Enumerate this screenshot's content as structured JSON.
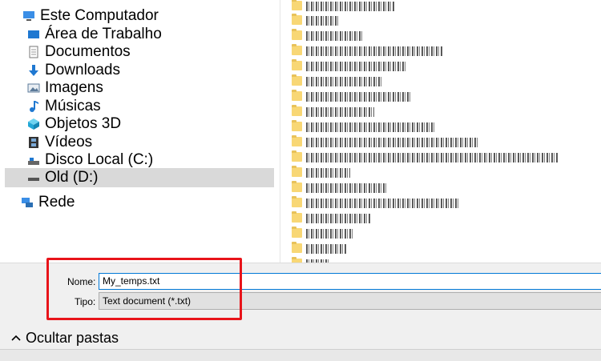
{
  "nav": {
    "items": [
      {
        "label": "Este Computador",
        "icon": "computer-icon"
      },
      {
        "label": "Área de Trabalho",
        "icon": "desktop-icon"
      },
      {
        "label": "Documentos",
        "icon": "document-icon"
      },
      {
        "label": "Downloads",
        "icon": "download-arrow-icon"
      },
      {
        "label": "Imagens",
        "icon": "image-icon"
      },
      {
        "label": "Músicas",
        "icon": "music-note-icon"
      },
      {
        "label": "Objetos 3D",
        "icon": "cube-icon"
      },
      {
        "label": "Vídeos",
        "icon": "film-icon"
      },
      {
        "label": "Disco Local (C:)",
        "icon": "drive-icon"
      },
      {
        "label": "Old (D:)",
        "icon": "drive-icon"
      },
      {
        "label": "Rede",
        "icon": "network-icon"
      }
    ],
    "selected": "Old (D:)"
  },
  "files": {
    "count": 18,
    "icon": "folder-icon"
  },
  "save": {
    "name_label": "Nome:",
    "name_value": "My_temps.txt",
    "type_label": "Tipo:",
    "type_value": "Text document (*.txt)"
  },
  "toggle": {
    "label": "Ocultar pastas",
    "icon": "chevron-up-icon"
  },
  "colors": {
    "highlight": "#e8141a",
    "selection": "#d9d9d9",
    "input_border": "#0078d7",
    "folder": "#f8d775"
  }
}
